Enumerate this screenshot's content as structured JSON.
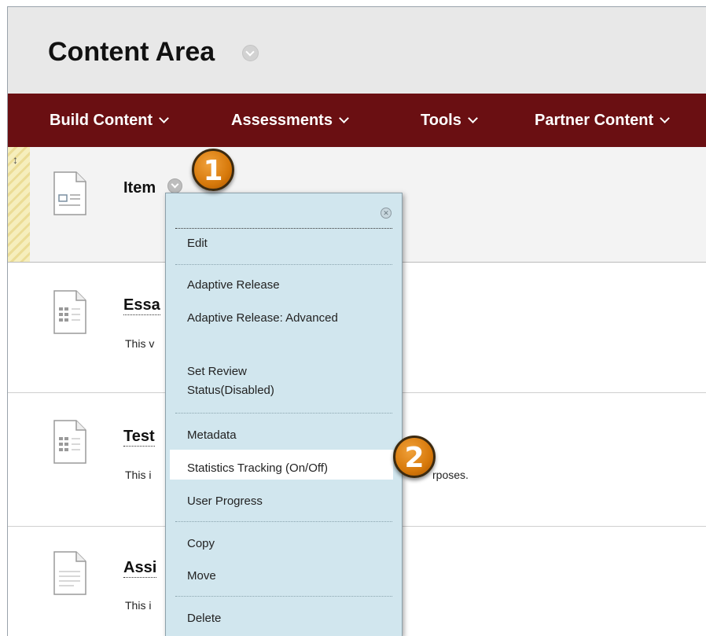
{
  "header": {
    "title": "Content Area"
  },
  "menubar": {
    "items": [
      {
        "label": "Build Content"
      },
      {
        "label": "Assessments"
      },
      {
        "label": "Tools"
      },
      {
        "label": "Partner Content"
      }
    ]
  },
  "content_items": [
    {
      "title": "Item",
      "description": ""
    },
    {
      "title": "Essa",
      "description": "This v"
    },
    {
      "title": "Test",
      "description": "This i",
      "trailing_text": "rposes."
    },
    {
      "title": "Assi",
      "description": "This i"
    }
  ],
  "context_menu": {
    "close_icon": "close-icon",
    "items": [
      {
        "label": "Edit"
      },
      {
        "label": "Adaptive Release"
      },
      {
        "label": "Adaptive Release: Advanced"
      },
      {
        "label": "Set Review Status(Disabled)"
      },
      {
        "label": "Metadata"
      },
      {
        "label": "Statistics Tracking (On/Off)"
      },
      {
        "label": "User Progress"
      },
      {
        "label": "Copy"
      },
      {
        "label": "Move"
      },
      {
        "label": "Delete"
      }
    ]
  },
  "callouts": {
    "step1": "1",
    "step2": "2"
  },
  "colors": {
    "menubar": "#6a0f12",
    "header": "#e8e8e8",
    "context_menu": "#d1e6ee",
    "badge": "#d7790b"
  }
}
